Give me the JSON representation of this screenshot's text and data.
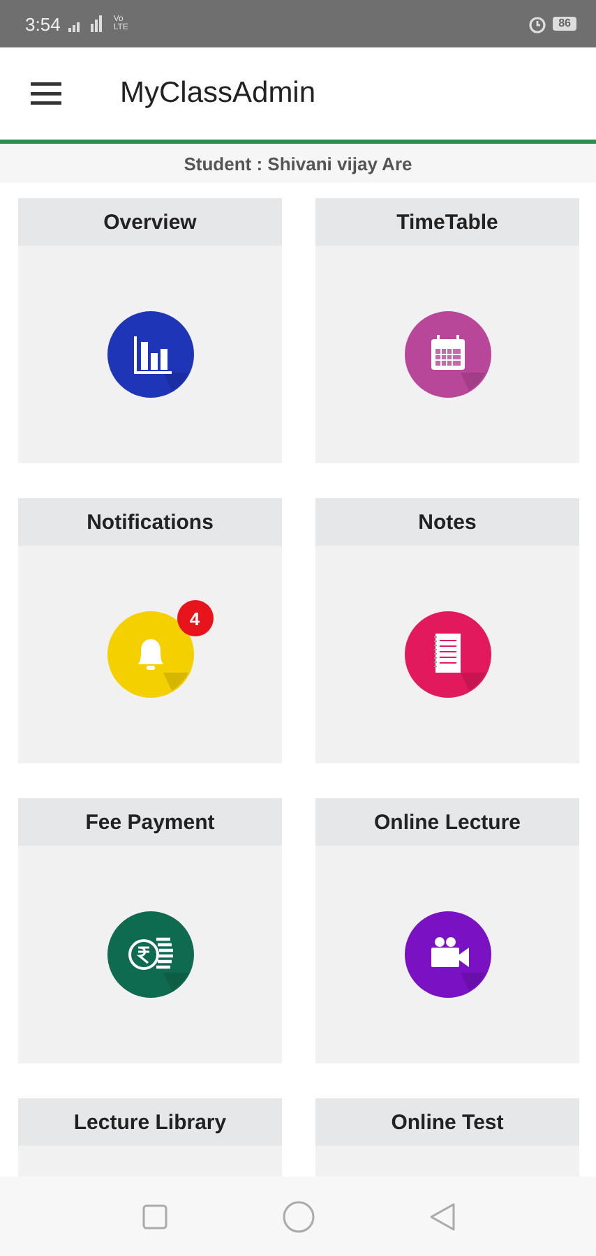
{
  "status_bar": {
    "time": "3:54",
    "network": "Vo LTE",
    "battery": "86"
  },
  "app_bar": {
    "title": "MyClassAdmin"
  },
  "student": "Student : Shivani vijay Are",
  "tiles": [
    {
      "label": "Overview",
      "kind": "chart",
      "color": "#1f35b8"
    },
    {
      "label": "TimeTable",
      "kind": "calendar",
      "color": "#b8479a"
    },
    {
      "label": "Notifications",
      "kind": "bell",
      "color": "#f5d000",
      "badge": "4"
    },
    {
      "label": "Notes",
      "kind": "notes",
      "color": "#e3195e"
    },
    {
      "label": "Fee Payment",
      "kind": "rupee",
      "color": "#0f6b4f"
    },
    {
      "label": "Online Lecture",
      "kind": "video",
      "color": "#7a12c4"
    },
    {
      "label": "Lecture Library"
    },
    {
      "label": "Online Test"
    }
  ]
}
